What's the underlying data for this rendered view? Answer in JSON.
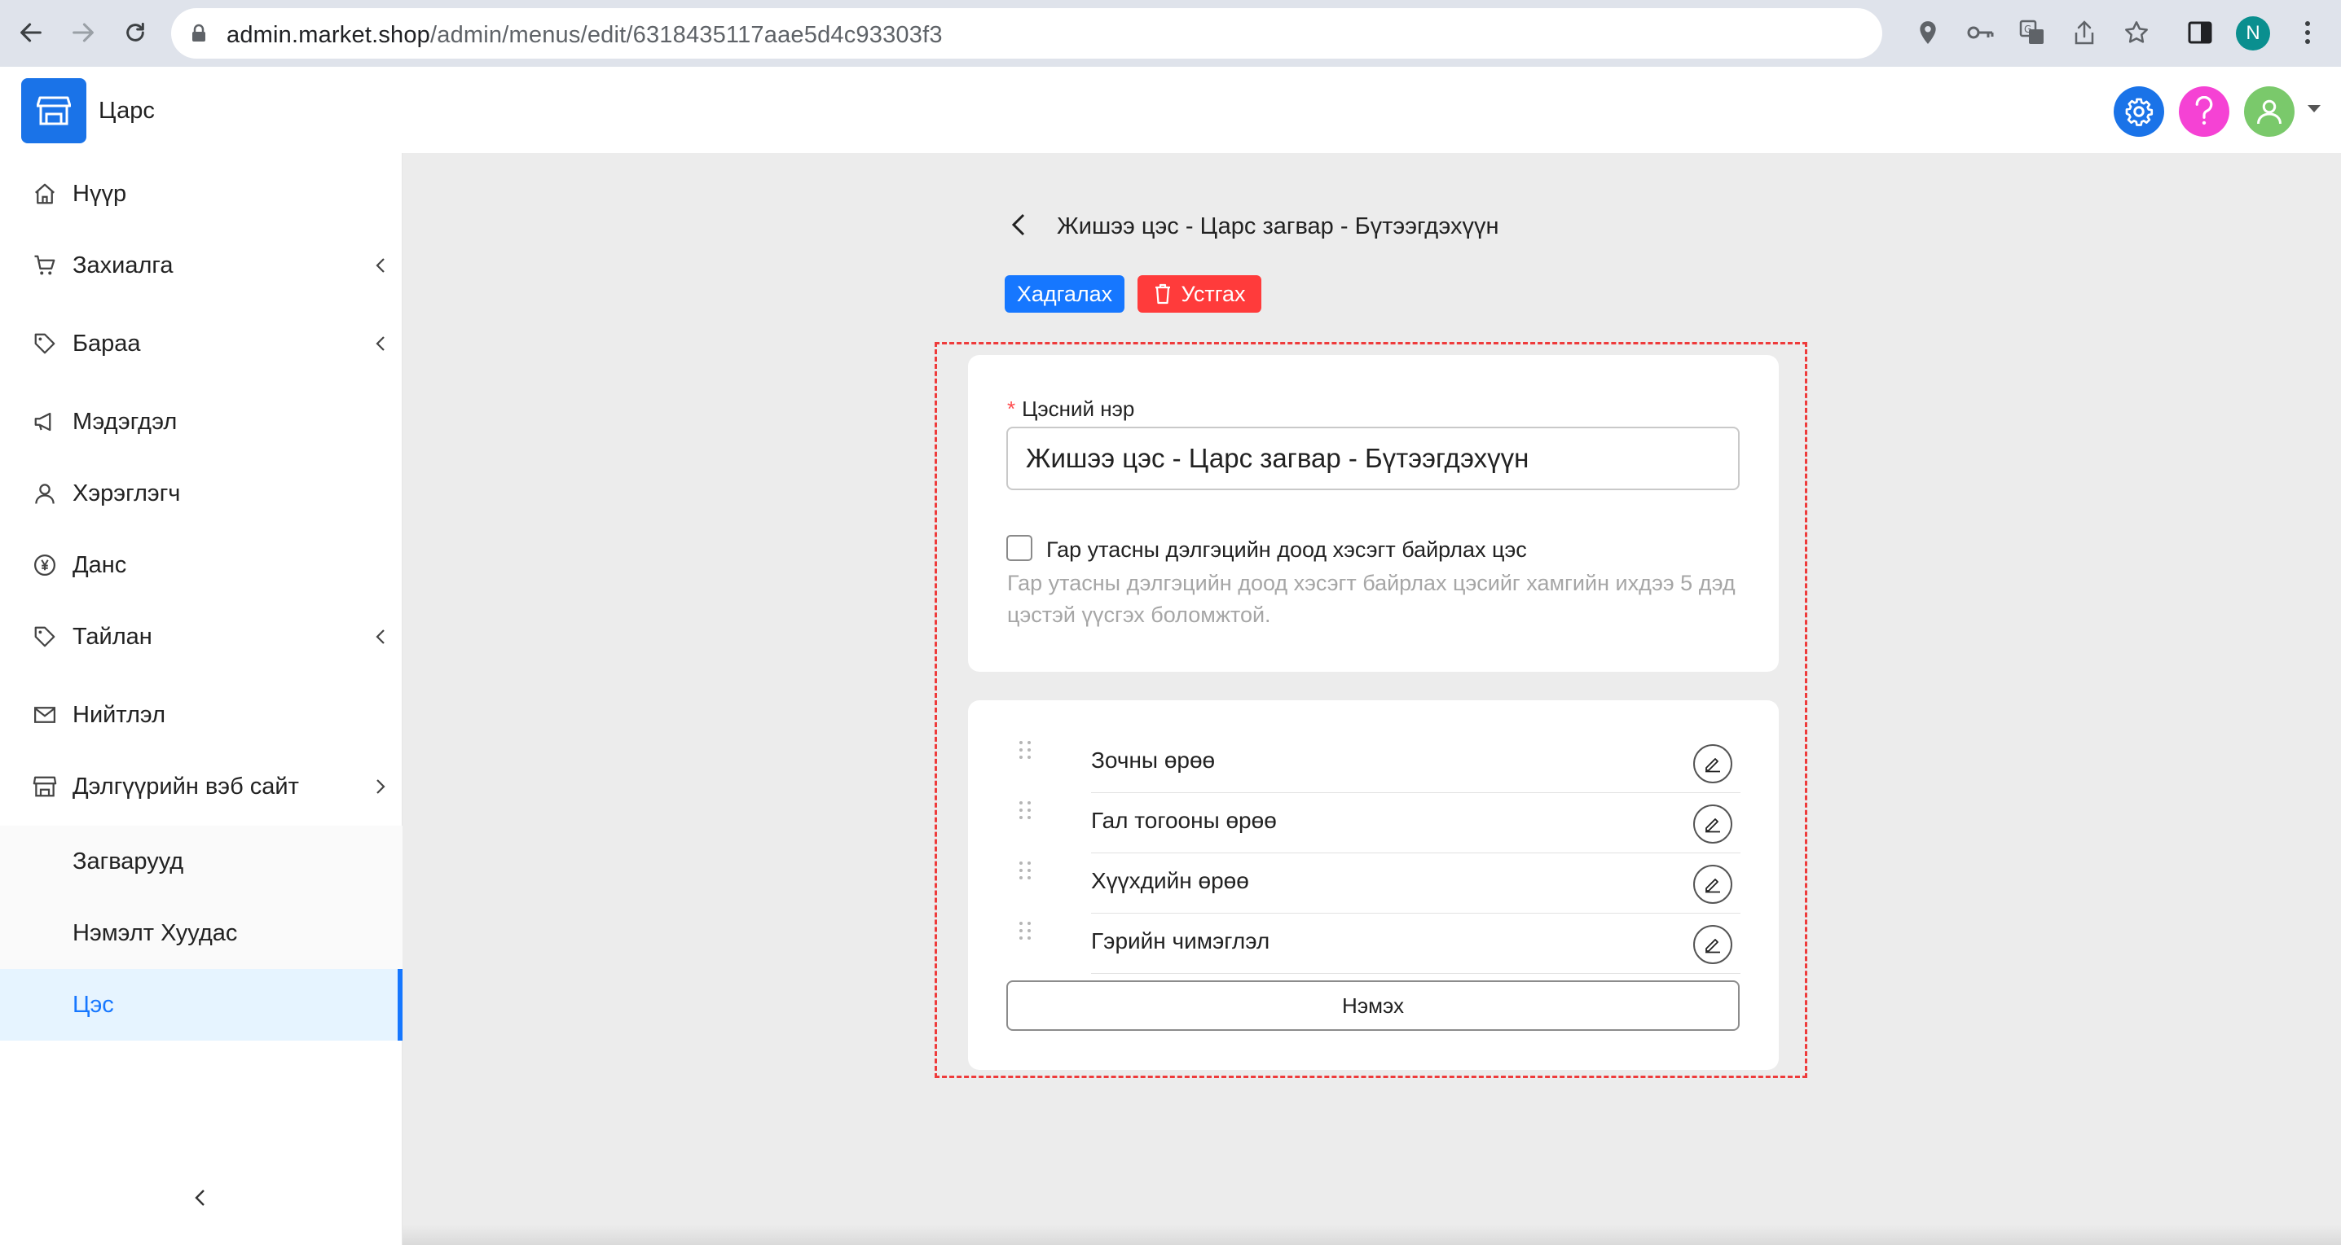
{
  "browser": {
    "url_host": "admin.market.shop",
    "url_path": "/admin/menus/edit/6318435117aae5d4c93303f3",
    "profile_initial": "N"
  },
  "header": {
    "store_name": "Царс",
    "settings_color": "#1a73e8",
    "help_color": "#f542d4",
    "avatar_color": "#7ac96b"
  },
  "sidebar": {
    "items": [
      {
        "label": "Нүүр",
        "icon": "home-icon"
      },
      {
        "label": "Захиалга",
        "icon": "cart-icon"
      },
      {
        "label": "Бараа",
        "icon": "tag-icon"
      },
      {
        "label": "Мэдэгдэл",
        "icon": "megaphone-icon"
      },
      {
        "label": "Хэрэглэгч",
        "icon": "user-icon"
      },
      {
        "label": "Данс",
        "icon": "currency-icon"
      },
      {
        "label": "Тайлан",
        "icon": "tag-icon"
      },
      {
        "label": "Нийтлэл",
        "icon": "mail-icon"
      },
      {
        "label": "Дэлгүүрийн вэб сайт",
        "icon": "store-icon"
      }
    ],
    "sub_items": [
      {
        "label": "Загварууд"
      },
      {
        "label": "Нэмэлт Хуудас"
      },
      {
        "label": "Цэс",
        "active": true
      }
    ]
  },
  "page": {
    "title": "Жишээ цэс - Царс загвар - Бүтээгдэхүүн",
    "save_label": "Хадгалах",
    "delete_label": "Устгах"
  },
  "form": {
    "name_label": "Цэсний нэр",
    "name_value": "Жишээ цэс - Царс загвар - Бүтээгдэхүүн",
    "mobile_checkbox_label": "Гар утасны дэлгэцийн доод хэсэгт байрлах цэс",
    "mobile_checkbox_checked": false,
    "help_text": "Гар утасны дэлгэцийн доод хэсэгт байрлах цэсийг хамгийн ихдээ 5 дэд цэстэй үүсгэх боломжтой."
  },
  "menu_items": [
    {
      "label": "Зочны өрөө"
    },
    {
      "label": "Гал тогооны өрөө"
    },
    {
      "label": "Хүүхдийн өрөө"
    },
    {
      "label": "Гэрийн чимэглэл"
    }
  ],
  "add_label": "Нэмэх"
}
